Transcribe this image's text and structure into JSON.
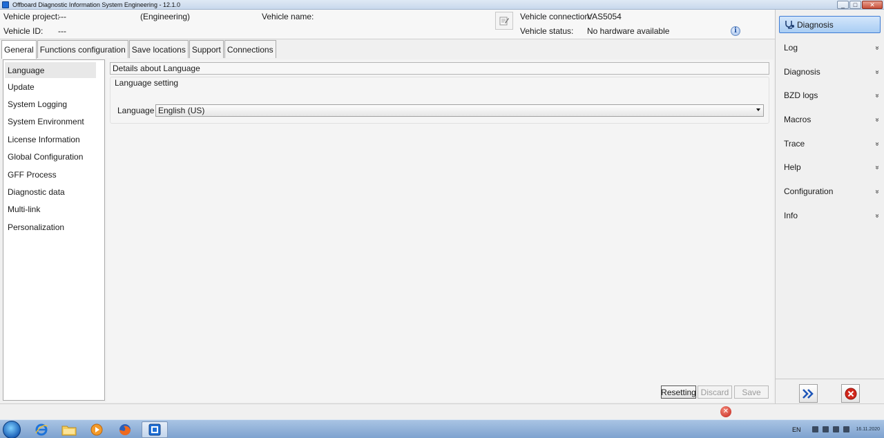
{
  "window": {
    "title": "Offboard Diagnostic Information System Engineering - 12.1.0",
    "min": "_",
    "max": "□",
    "close": "✕"
  },
  "header": {
    "vehicle_project_label": "Vehicle project:",
    "vehicle_project_value": "---",
    "mode": "(Engineering)",
    "vehicle_name_label": "Vehicle name:",
    "vehicle_id_label": "Vehicle ID:",
    "vehicle_id_value": "---",
    "vehicle_connection_label": "Vehicle connection:",
    "vehicle_connection_value": "VAS5054",
    "vehicle_status_label": "Vehicle status:",
    "vehicle_status_value": "No hardware available",
    "info_glyph": "i"
  },
  "tabs": [
    {
      "label": "General",
      "active": true
    },
    {
      "label": "Functions configuration"
    },
    {
      "label": "Save locations"
    },
    {
      "label": "Support"
    },
    {
      "label": "Connections"
    }
  ],
  "nav": [
    {
      "label": "Language",
      "selected": true
    },
    {
      "label": "Update"
    },
    {
      "label": "System Logging"
    },
    {
      "label": "System Environment"
    },
    {
      "label": "License Information"
    },
    {
      "label": "Global Configuration"
    },
    {
      "label": "GFF Process"
    },
    {
      "label": "Diagnostic data"
    },
    {
      "label": "Multi-link"
    },
    {
      "label": "Personalization"
    }
  ],
  "details": {
    "title": "Details about Language",
    "group_title": "Language setting",
    "language_label": "Language",
    "language_value": "English (US)"
  },
  "buttons": {
    "resetting": "Resetting",
    "discard": "Discard",
    "save": "Save"
  },
  "right_panel": {
    "diagnosis_button": "Diagnosis",
    "items": [
      {
        "label": "Log"
      },
      {
        "label": "Diagnosis"
      },
      {
        "label": "BZD logs"
      },
      {
        "label": "Macros"
      },
      {
        "label": "Trace"
      },
      {
        "label": "Help"
      },
      {
        "label": "Configuration"
      },
      {
        "label": "Info"
      }
    ],
    "chevron": "»"
  },
  "status": {
    "error_glyph": "✕"
  },
  "taskbar": {
    "lang": "EN",
    "date": "16.11.2020"
  },
  "colors": {
    "accent": "#3d7bd4",
    "error": "#c2231a"
  }
}
